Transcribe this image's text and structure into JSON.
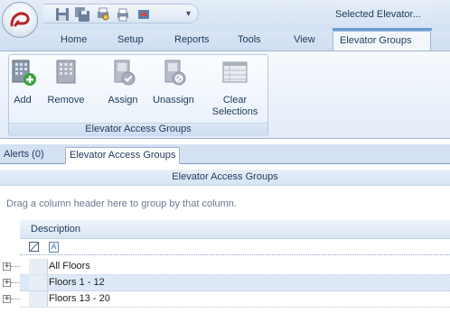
{
  "title_bar": {
    "window_caption": "Selected  Elevator...",
    "quick_access_icons": [
      "save-icon",
      "save-all-icon",
      "print-preview-icon",
      "print-icon",
      "refresh-icon"
    ],
    "customize_arrow": "▾"
  },
  "ribbon_tabs": [
    "Home",
    "Setup",
    "Reports",
    "Tools",
    "View"
  ],
  "active_tab": "Elevator Groups",
  "ribbon_group": {
    "caption": "Elevator Access Groups",
    "buttons": [
      {
        "label": "Add",
        "icon": "building-add-icon"
      },
      {
        "label": "Remove",
        "icon": "building-remove-icon"
      },
      {
        "label": "Assign",
        "icon": "assign-icon"
      },
      {
        "label": "Unassign",
        "icon": "unassign-icon"
      },
      {
        "label": "Clear\nSelections",
        "icon": "clear-selections-icon"
      }
    ]
  },
  "doc_tabs": [
    "Alerts (0)",
    "Elevator Access Groups"
  ],
  "grid": {
    "title": "Elevator Access Groups",
    "group_panel_text": "Drag a column header here to group by that column.",
    "column_header": "Description",
    "filter_cell_glyph": "A",
    "rows": [
      "All Floors",
      "Floors 1 - 12",
      "Floors 13 - 20"
    ],
    "expander_glyph": "+"
  },
  "colors": {
    "accent": "#6a9fd5",
    "selected_row": "#dde9f6",
    "text": "#1e395b"
  }
}
